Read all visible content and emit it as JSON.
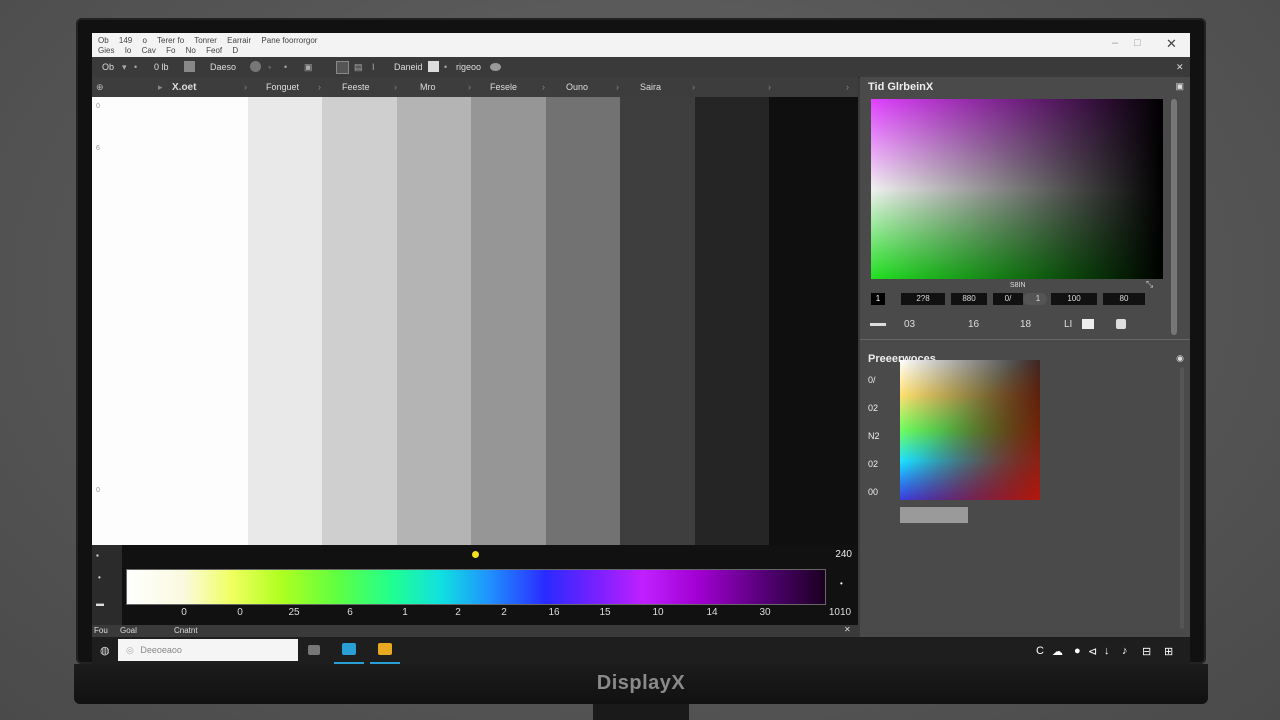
{
  "monitor": {
    "brand": "DisplayX"
  },
  "titlebar": {
    "line1": [
      "Ob",
      "149",
      "o",
      "Terer fo",
      "Tonrer",
      "Earrair",
      "Pane foorrorgor"
    ],
    "line2": [
      "Gies",
      "Io",
      "Cav",
      "Fo",
      "No",
      "Feof",
      "D"
    ],
    "controls": {
      "minimize": "–",
      "maximize": "□",
      "close": "✕"
    }
  },
  "toolbar": {
    "items": [
      "Ob",
      "0 lb",
      "Daeso",
      "Daneid",
      "rigeoo"
    ],
    "close_label": "✕"
  },
  "tabs": {
    "labels": [
      "X.oet",
      "Fonguet",
      "Feeste",
      "Mro",
      "Fesele",
      "Ouno",
      "Saira"
    ],
    "left_icon": "⊕"
  },
  "canvas": {
    "strip_colors": [
      "#fdfdfd",
      "#e9e9e9",
      "#cfcfcf",
      "#b4b4b4",
      "#969696",
      "#727272",
      "#3e3e3e",
      "#252525",
      "#0f0f0f"
    ],
    "ruler_marks": [
      "0",
      "6",
      "0"
    ]
  },
  "spectrum": {
    "value": "240",
    "ticks": [
      "0",
      "0",
      "25",
      "6",
      "1",
      "2",
      "2",
      "16",
      "15",
      "10",
      "14",
      "30",
      "1010"
    ],
    "left_marks": [
      "▪",
      "•",
      "▬"
    ]
  },
  "statusline": {
    "items": [
      "Fou",
      "Goal",
      "Cnatnt"
    ],
    "close": "✕"
  },
  "color_panel": {
    "title": "Tid GlrbeinX",
    "caption": "S8IN",
    "rgb_cells": [
      "1",
      "2?8",
      "880",
      "0/",
      "1",
      "100",
      "80"
    ],
    "values": [
      "03",
      "16",
      "18",
      "LI"
    ]
  },
  "prefs_panel": {
    "title": "Preeerwoces",
    "items": [
      "0/",
      "02",
      "N2",
      "02",
      "00"
    ]
  },
  "taskbar": {
    "search_placeholder": "Deeoeaoo",
    "tray": [
      "C",
      "☁",
      "●",
      "⊲",
      "↓",
      "♪",
      "⊟",
      "⊞"
    ]
  },
  "colors": {
    "taskbar_app1": "#2a9fd6",
    "taskbar_app2": "#e8a820",
    "spectrum_marker": "#f0e020"
  }
}
